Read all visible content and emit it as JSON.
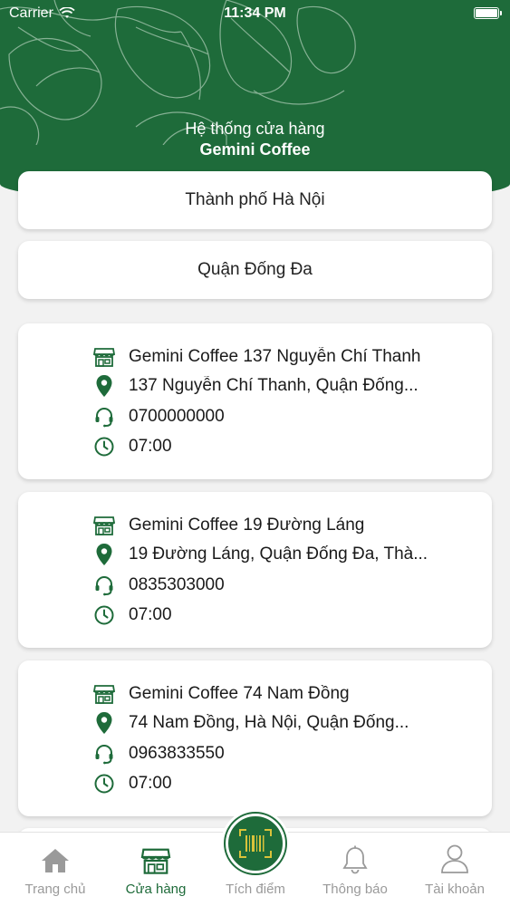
{
  "status_bar": {
    "carrier": "Carrier",
    "time": "11:34 PM"
  },
  "header": {
    "line1": "Hệ thống cửa hàng",
    "line2": "Gemini Coffee"
  },
  "filters": {
    "city": "Thành phố Hà Nội",
    "district": "Quận Đống Đa"
  },
  "stores": [
    {
      "name": "Gemini Coffee 137 Nguyễn Chí Thanh",
      "address": "137 Nguyễn Chí Thanh, Quận Đống...",
      "phone": "0700000000",
      "open_time": "07:00"
    },
    {
      "name": "Gemini Coffee 19 Đường Láng",
      "address": "19 Đường Láng, Quận Đống Đa, Thà...",
      "phone": "0835303000",
      "open_time": "07:00"
    },
    {
      "name": "Gemini Coffee 74 Nam Đồng",
      "address": "74 Nam Đồng, Hà Nội, Quận Đống...",
      "phone": "0963833550",
      "open_time": "07:00"
    }
  ],
  "tabbar": {
    "home": "Trang chủ",
    "stores": "Cửa hàng",
    "points": "Tích điểm",
    "notifications": "Thông báo",
    "account": "Tài khoản"
  },
  "colors": {
    "brand_green": "#1e6b3a",
    "inactive_gray": "#9a9a9a"
  }
}
